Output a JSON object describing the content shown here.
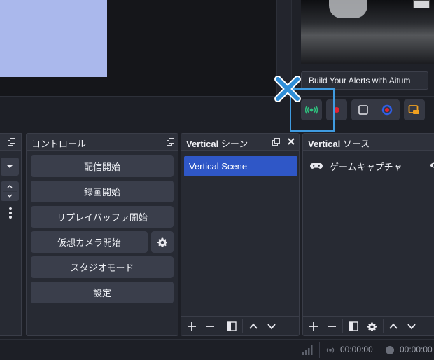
{
  "tooltip": {
    "text": "Build Your Alerts with Aitum"
  },
  "vertical_controls": {
    "stream_icon": "broadcast-icon",
    "record_icon": "record-dot-icon",
    "stop_icon": "square-icon",
    "replay_icon": "replay-ring-icon",
    "virtualcam_icon": "camera-icon",
    "colors": {
      "stream": "#2ec27e",
      "record": "#e5202f",
      "replay_outer": "#2f5fe8",
      "replay_inner": "#e5202f",
      "virtualcam": "#f0a020",
      "highlight": "#3f9be0"
    }
  },
  "controls_dock": {
    "title": "コントロール",
    "buttons": [
      "配信開始",
      "録画開始",
      "リプレイバッファ開始",
      "仮想カメラ開始",
      "スタジオモード",
      "設定"
    ]
  },
  "scenes_dock": {
    "title_prefix": "Vertical",
    "title_suffix": " シーン",
    "items": [
      "Vertical Scene"
    ]
  },
  "sources_dock": {
    "title_prefix": "Vertical",
    "title_suffix": " ソース",
    "items": [
      {
        "label": "ゲームキャプチャ",
        "icon": "gamepad-icon"
      }
    ]
  },
  "statusbar": {
    "stream_time": "00:00:00",
    "record_time": "00:00:00"
  }
}
